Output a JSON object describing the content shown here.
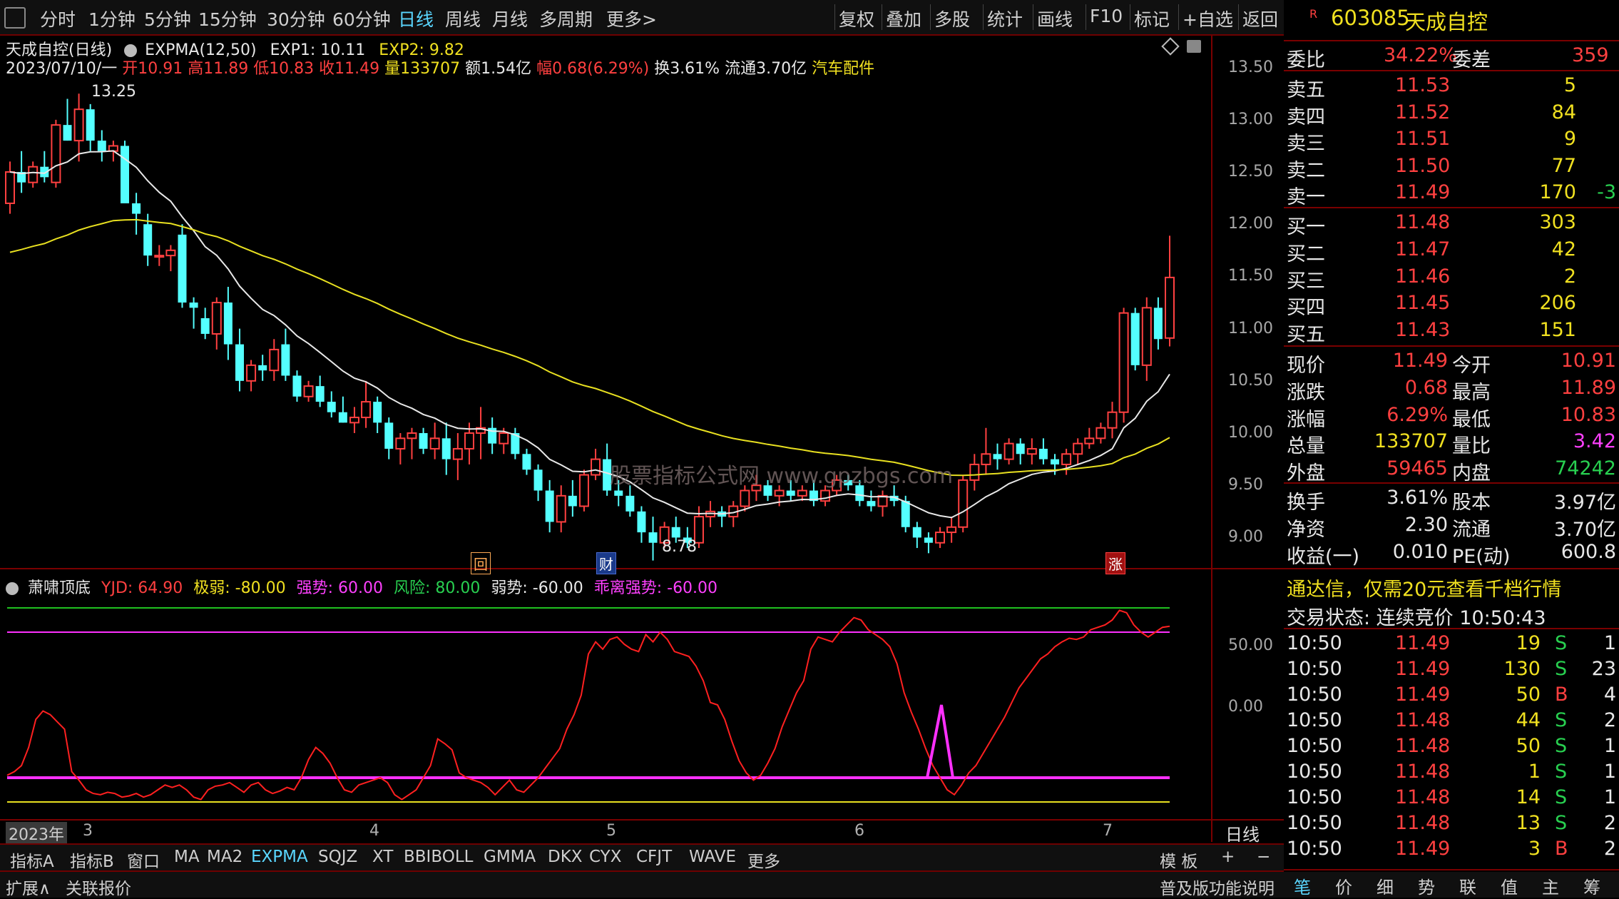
{
  "toolbar": {
    "left_tabs": [
      "分时",
      "1分钟",
      "5分钟",
      "15分钟",
      "30分钟",
      "60分钟",
      "日线",
      "周线",
      "月线",
      "多周期",
      "更多>"
    ],
    "active_tab": "日线",
    "right_buttons": [
      "复权",
      "叠加",
      "多股",
      "统计",
      "画线",
      "F10",
      "标记",
      "+自选",
      "返回"
    ]
  },
  "chart_header": {
    "name": "天成自控(日线)",
    "indicator": "EXPMA(12,50)",
    "exp1": "EXP1: 10.11",
    "exp2": "EXP2: 9.82",
    "date": "2023/07/10/一",
    "open": "开10.91",
    "high": "高11.89",
    "low": "低10.83",
    "close": "收11.49",
    "volume": "量133707",
    "amount": "额1.54亿",
    "change": "幅0.68(6.29%)",
    "turnover": "换3.61%",
    "float": "流通3.70亿",
    "sector": "汽车配件"
  },
  "price_axis": [
    "13.50",
    "13.00",
    "12.50",
    "12.00",
    "11.50",
    "11.00",
    "10.50",
    "10.00",
    "9.50",
    "9.00"
  ],
  "annotations": {
    "high_label": "13.25",
    "low_label": "8.78",
    "watermark": "股票指标公式网 www.gpzbgs.com"
  },
  "markers": {
    "m1": "回",
    "m2": "财",
    "m3": "涨"
  },
  "indicator_header": {
    "name": "萧啸顶底",
    "yjd": "YJD: 64.90",
    "jiruo": "极弱: -80.00",
    "qiangshi": "强势: 60.00",
    "fengxian": "风险: 80.00",
    "ruoshi": "弱势: -60.00",
    "guaili": "乖离强势: -60.00"
  },
  "indicator_axis": [
    "50.00",
    "0.00"
  ],
  "time_axis": {
    "year": "2023年",
    "months": [
      "3",
      "4",
      "5",
      "6",
      "7"
    ],
    "period": "日线"
  },
  "bottom_tabs": [
    "指标A",
    "指标B",
    "窗口",
    "MA",
    "MA2",
    "EXPMA",
    "SQJZ",
    "XT",
    "BBIBOLL",
    "GMMA",
    "DKX",
    "CYX",
    "CFJT",
    "WAVE",
    "更多"
  ],
  "active_bottom_tab": "EXPMA",
  "template_btn": "模 板",
  "status_bar": {
    "expand": "扩展∧",
    "related": "关联报价",
    "right": "普及版功能说明"
  },
  "right_panel": {
    "code": "603085",
    "stock_name": "天成自控",
    "r_badge": "R",
    "weibi_label": "委比",
    "weibi": "34.22%",
    "weicha_label": "委差",
    "weicha": "359",
    "asks": [
      {
        "label": "卖五",
        "price": "11.53",
        "vol": "5",
        "chg": ""
      },
      {
        "label": "卖四",
        "price": "11.52",
        "vol": "84",
        "chg": ""
      },
      {
        "label": "卖三",
        "price": "11.51",
        "vol": "9",
        "chg": ""
      },
      {
        "label": "卖二",
        "price": "11.50",
        "vol": "77",
        "chg": ""
      },
      {
        "label": "卖一",
        "price": "11.49",
        "vol": "170",
        "chg": "-3"
      }
    ],
    "bids": [
      {
        "label": "买一",
        "price": "11.48",
        "vol": "303"
      },
      {
        "label": "买二",
        "price": "11.47",
        "vol": "42"
      },
      {
        "label": "买三",
        "price": "11.46",
        "vol": "2"
      },
      {
        "label": "买四",
        "price": "11.45",
        "vol": "206"
      },
      {
        "label": "买五",
        "price": "11.43",
        "vol": "151"
      }
    ],
    "quotes": [
      {
        "l1": "现价",
        "v1": "11.49",
        "l2": "今开",
        "v2": "10.91"
      },
      {
        "l1": "涨跌",
        "v1": "0.68",
        "l2": "最高",
        "v2": "11.89"
      },
      {
        "l1": "涨幅",
        "v1": "6.29%",
        "l2": "最低",
        "v2": "10.83"
      },
      {
        "l1": "总量",
        "v1": "133707",
        "l2": "量比",
        "v2": "3.42"
      },
      {
        "l1": "外盘",
        "v1": "59465",
        "l2": "内盘",
        "v2": "74242"
      }
    ],
    "fund": [
      {
        "l1": "换手",
        "v1": "3.61%",
        "l2": "股本",
        "v2": "3.97亿"
      },
      {
        "l1": "净资",
        "v1": "2.30",
        "l2": "流通",
        "v2": "3.70亿"
      },
      {
        "l1": "收益(一)",
        "v1": "0.010",
        "l2": "PE(动)",
        "v2": "600.8"
      }
    ],
    "promo": "通达信，仅需20元查看千档行情",
    "trade_status": "交易状态: 连续竞价 10:50:43",
    "ticks": [
      {
        "t": "10:50",
        "p": "11.49",
        "v": "19",
        "s": "S",
        "n": "1"
      },
      {
        "t": "10:50",
        "p": "11.49",
        "v": "130",
        "s": "S",
        "n": "23"
      },
      {
        "t": "10:50",
        "p": "11.49",
        "v": "50",
        "s": "B",
        "n": "4"
      },
      {
        "t": "10:50",
        "p": "11.48",
        "v": "44",
        "s": "S",
        "n": "2"
      },
      {
        "t": "10:50",
        "p": "11.48",
        "v": "50",
        "s": "S",
        "n": "1"
      },
      {
        "t": "10:50",
        "p": "11.48",
        "v": "1",
        "s": "S",
        "n": "1"
      },
      {
        "t": "10:50",
        "p": "11.48",
        "v": "14",
        "s": "S",
        "n": "1"
      },
      {
        "t": "10:50",
        "p": "11.48",
        "v": "13",
        "s": "S",
        "n": "2"
      },
      {
        "t": "10:50",
        "p": "11.49",
        "v": "3",
        "s": "B",
        "n": "2"
      }
    ],
    "bottom_tabs": [
      "笔",
      "价",
      "细",
      "势",
      "联",
      "值",
      "主",
      "筹"
    ]
  },
  "colors": {
    "up": "#ff4040",
    "down": "#54ffff",
    "exp1": "#e8e8e8",
    "exp2": "#e8e020",
    "yjd": "#ff2020",
    "magenta": "#ff30ff",
    "green": "#20c020",
    "yellow": "#e8e020"
  },
  "chart_data": {
    "type": "candlestick",
    "price_range": [
      8.75,
      13.6
    ],
    "candles": [
      [
        12.2,
        12.6,
        12.1,
        12.5
      ],
      [
        12.5,
        12.7,
        12.3,
        12.4
      ],
      [
        12.4,
        12.6,
        12.35,
        12.55
      ],
      [
        12.55,
        12.7,
        12.4,
        12.45
      ],
      [
        12.4,
        13.0,
        12.35,
        12.95
      ],
      [
        12.95,
        13.2,
        12.8,
        12.8
      ],
      [
        12.8,
        13.25,
        12.6,
        13.1
      ],
      [
        13.1,
        13.15,
        12.7,
        12.8
      ],
      [
        12.8,
        12.9,
        12.6,
        12.7
      ],
      [
        12.7,
        12.8,
        12.6,
        12.75
      ],
      [
        12.75,
        12.8,
        12.3,
        12.2
      ],
      [
        12.2,
        12.3,
        11.9,
        12.1
      ],
      [
        12.0,
        12.1,
        11.6,
        11.7
      ],
      [
        11.7,
        11.8,
        11.6,
        11.7
      ],
      [
        11.7,
        11.8,
        11.55,
        11.75
      ],
      [
        11.9,
        12.0,
        11.2,
        11.25
      ],
      [
        11.25,
        11.3,
        11.0,
        11.2
      ],
      [
        11.1,
        11.2,
        10.9,
        10.95
      ],
      [
        10.95,
        11.3,
        10.8,
        11.25
      ],
      [
        11.25,
        11.4,
        10.7,
        10.85
      ],
      [
        10.85,
        11.0,
        10.4,
        10.5
      ],
      [
        10.5,
        10.7,
        10.4,
        10.65
      ],
      [
        10.65,
        10.75,
        10.5,
        10.6
      ],
      [
        10.6,
        10.9,
        10.5,
        10.8
      ],
      [
        10.85,
        11.0,
        10.5,
        10.55
      ],
      [
        10.55,
        10.6,
        10.3,
        10.35
      ],
      [
        10.35,
        10.5,
        10.3,
        10.45
      ],
      [
        10.45,
        10.55,
        10.25,
        10.3
      ],
      [
        10.3,
        10.4,
        10.15,
        10.2
      ],
      [
        10.2,
        10.35,
        10.1,
        10.1
      ],
      [
        10.1,
        10.25,
        10.0,
        10.15
      ],
      [
        10.15,
        10.5,
        10.05,
        10.3
      ],
      [
        10.3,
        10.35,
        10.0,
        10.1
      ],
      [
        10.1,
        10.15,
        9.75,
        9.85
      ],
      [
        9.85,
        10.0,
        9.7,
        9.95
      ],
      [
        9.95,
        10.05,
        9.75,
        10.0
      ],
      [
        10.0,
        10.05,
        9.8,
        9.85
      ],
      [
        9.85,
        10.1,
        9.75,
        9.95
      ],
      [
        9.95,
        10.1,
        9.6,
        9.75
      ],
      [
        9.75,
        10.0,
        9.55,
        9.85
      ],
      [
        9.85,
        10.1,
        9.7,
        10.0
      ],
      [
        10.0,
        10.25,
        9.75,
        10.05
      ],
      [
        10.05,
        10.15,
        9.8,
        9.9
      ],
      [
        9.9,
        10.05,
        9.8,
        10.0
      ],
      [
        10.0,
        10.05,
        9.75,
        9.8
      ],
      [
        9.8,
        9.85,
        9.6,
        9.65
      ],
      [
        9.65,
        9.7,
        9.35,
        9.45
      ],
      [
        9.45,
        9.55,
        9.05,
        9.15
      ],
      [
        9.15,
        9.5,
        9.05,
        9.4
      ],
      [
        9.4,
        9.55,
        9.2,
        9.3
      ],
      [
        9.3,
        9.65,
        9.25,
        9.6
      ],
      [
        9.6,
        9.85,
        9.55,
        9.75
      ],
      [
        9.75,
        9.9,
        9.4,
        9.45
      ],
      [
        9.45,
        9.55,
        9.3,
        9.4
      ],
      [
        9.4,
        9.5,
        9.2,
        9.25
      ],
      [
        9.25,
        9.3,
        8.95,
        9.05
      ],
      [
        9.05,
        9.2,
        8.78,
        8.95
      ],
      [
        8.95,
        9.15,
        8.9,
        9.1
      ],
      [
        9.1,
        9.2,
        8.95,
        9.0
      ],
      [
        9.0,
        9.1,
        8.9,
        8.95
      ],
      [
        8.95,
        9.3,
        8.9,
        9.2
      ],
      [
        9.2,
        9.35,
        9.1,
        9.25
      ],
      [
        9.25,
        9.3,
        9.1,
        9.2
      ],
      [
        9.2,
        9.35,
        9.1,
        9.3
      ],
      [
        9.3,
        9.5,
        9.25,
        9.45
      ],
      [
        9.45,
        9.6,
        9.35,
        9.5
      ],
      [
        9.5,
        9.55,
        9.35,
        9.4
      ],
      [
        9.4,
        9.5,
        9.3,
        9.45
      ],
      [
        9.45,
        9.55,
        9.35,
        9.4
      ],
      [
        9.4,
        9.5,
        9.35,
        9.45
      ],
      [
        9.45,
        9.55,
        9.3,
        9.35
      ],
      [
        9.35,
        9.5,
        9.3,
        9.45
      ],
      [
        9.45,
        9.6,
        9.4,
        9.55
      ],
      [
        9.55,
        9.6,
        9.45,
        9.5
      ],
      [
        9.5,
        9.55,
        9.3,
        9.35
      ],
      [
        9.35,
        9.45,
        9.25,
        9.3
      ],
      [
        9.3,
        9.45,
        9.2,
        9.4
      ],
      [
        9.4,
        9.5,
        9.3,
        9.35
      ],
      [
        9.35,
        9.4,
        9.05,
        9.1
      ],
      [
        9.1,
        9.15,
        8.9,
        9.0
      ],
      [
        9.0,
        9.05,
        8.85,
        8.95
      ],
      [
        8.95,
        9.1,
        8.9,
        9.05
      ],
      [
        9.05,
        9.2,
        8.95,
        9.1
      ],
      [
        9.1,
        9.6,
        9.05,
        9.55
      ],
      [
        9.55,
        9.8,
        9.45,
        9.7
      ],
      [
        9.7,
        10.05,
        9.6,
        9.8
      ],
      [
        9.8,
        9.9,
        9.65,
        9.75
      ],
      [
        9.75,
        9.95,
        9.7,
        9.9
      ],
      [
        9.9,
        9.95,
        9.7,
        9.8
      ],
      [
        9.8,
        9.95,
        9.7,
        9.85
      ],
      [
        9.85,
        9.95,
        9.7,
        9.75
      ],
      [
        9.75,
        9.8,
        9.6,
        9.7
      ],
      [
        9.7,
        9.85,
        9.6,
        9.8
      ],
      [
        9.8,
        9.95,
        9.7,
        9.9
      ],
      [
        9.9,
        10.05,
        9.85,
        9.95
      ],
      [
        9.95,
        10.1,
        9.9,
        10.05
      ],
      [
        10.05,
        10.3,
        9.95,
        10.2
      ],
      [
        10.2,
        11.2,
        10.1,
        11.15
      ],
      [
        11.15,
        11.2,
        10.6,
        10.65
      ],
      [
        10.65,
        11.3,
        10.5,
        11.2
      ],
      [
        11.2,
        11.3,
        10.8,
        10.9
      ],
      [
        10.91,
        11.89,
        10.83,
        11.49
      ]
    ],
    "yjd": [
      -58,
      -55,
      -50,
      -35,
      -12,
      -5,
      -8,
      -14,
      -20,
      -55,
      -62,
      -70,
      -73,
      -74,
      -72,
      -73,
      -76,
      -75,
      -73,
      -76,
      -74,
      -70,
      -66,
      -68,
      -66,
      -70,
      -76,
      -78,
      -70,
      -67,
      -66,
      -64,
      -68,
      -72,
      -66,
      -64,
      -70,
      -73,
      -71,
      -68,
      -70,
      -60,
      -45,
      -35,
      -40,
      -48,
      -60,
      -70,
      -72,
      -66,
      -64,
      -62,
      -60,
      -64,
      -74,
      -78,
      -74,
      -70,
      -60,
      -50,
      -28,
      -32,
      -37,
      -56,
      -60,
      -62,
      -64,
      -68,
      -74,
      -68,
      -62,
      -70,
      -72,
      -66,
      -60,
      -52,
      -44,
      -36,
      -20,
      -8,
      8,
      42,
      52,
      46,
      54,
      56,
      50,
      46,
      44,
      58,
      52,
      60,
      54,
      44,
      42,
      40,
      32,
      20,
      2,
      0,
      -12,
      -30,
      -46,
      -56,
      -62,
      -58,
      -48,
      -36,
      -18,
      -4,
      10,
      20,
      46,
      56,
      54,
      52,
      60,
      66,
      72,
      70,
      62,
      58,
      54,
      48,
      34,
      10,
      -6,
      -20,
      -36,
      -50,
      -60,
      -70,
      -74,
      -66,
      -56,
      -50,
      -40,
      -30,
      -20,
      -10,
      2,
      14,
      22,
      30,
      38,
      42,
      48,
      52,
      55,
      54,
      56,
      62,
      64,
      66,
      70,
      78,
      76,
      66,
      60,
      56,
      60,
      64,
      64.9
    ]
  }
}
